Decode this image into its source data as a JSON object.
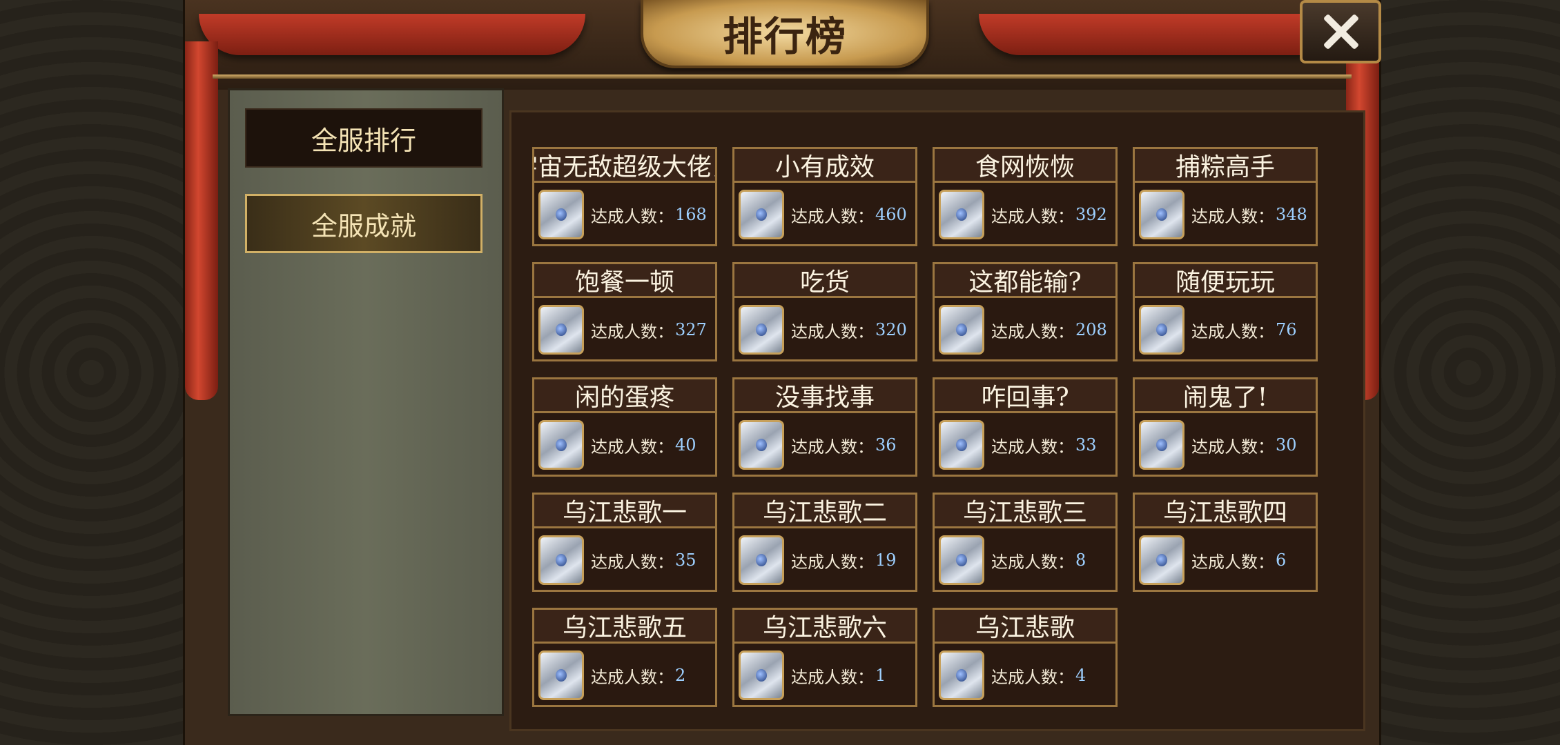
{
  "window": {
    "title": "排行榜",
    "close_icon": "close-icon"
  },
  "sidebar": {
    "tabs": [
      {
        "label": "全服排行",
        "active": false
      },
      {
        "label": "全服成就",
        "active": true
      }
    ]
  },
  "achievements": {
    "count_label": "达成人数：",
    "items": [
      {
        "name": "宇宙无敌超级大佬鼠",
        "count": "168"
      },
      {
        "name": "小有成效",
        "count": "460"
      },
      {
        "name": "食网恢恢",
        "count": "392"
      },
      {
        "name": "捕粽高手",
        "count": "348"
      },
      {
        "name": "饱餐一顿",
        "count": "327"
      },
      {
        "name": "吃货",
        "count": "320"
      },
      {
        "name": "这都能输?",
        "count": "208"
      },
      {
        "name": "随便玩玩",
        "count": "76"
      },
      {
        "name": "闲的蛋疼",
        "count": "40"
      },
      {
        "name": "没事找事",
        "count": "36"
      },
      {
        "name": "咋回事?",
        "count": "33"
      },
      {
        "name": "闹鬼了!",
        "count": "30"
      },
      {
        "name": "乌江悲歌一",
        "count": "35"
      },
      {
        "name": "乌江悲歌二",
        "count": "19"
      },
      {
        "name": "乌江悲歌三",
        "count": "8"
      },
      {
        "name": "乌江悲歌四",
        "count": "6"
      },
      {
        "name": "乌江悲歌五",
        "count": "2"
      },
      {
        "name": "乌江悲歌六",
        "count": "1"
      },
      {
        "name": "乌江悲歌",
        "count": "4"
      }
    ]
  }
}
